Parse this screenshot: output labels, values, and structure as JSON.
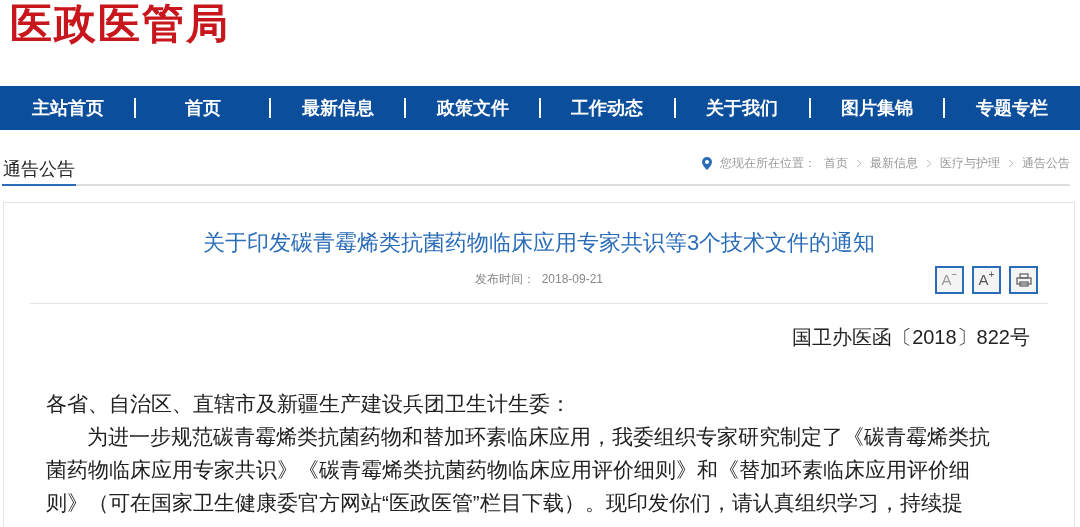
{
  "logo": "医政医管局",
  "nav": [
    "主站首页",
    "首页",
    "最新信息",
    "政策文件",
    "工作动态",
    "关于我们",
    "图片集锦",
    "专题专栏"
  ],
  "section_title": "通告公告",
  "breadcrumb": {
    "label": "您现在所在位置：",
    "items": [
      "首页",
      "最新信息",
      "医疗与护理",
      "通告公告"
    ]
  },
  "article": {
    "title": "关于印发碳青霉烯类抗菌药物临床应用专家共识等3个技术文件的通知",
    "date_label": "发布时间：",
    "date": "2018-09-21",
    "tools": [
      {
        "kind": "smaller",
        "label": "A",
        "mark": "−"
      },
      {
        "kind": "larger",
        "label": "A",
        "mark": "+"
      },
      {
        "kind": "print"
      }
    ],
    "doc_number": "国卫办医函〔2018〕822号",
    "greeting": "各省、自治区、直辖市及新疆生产建设兵团卫生计生委：",
    "paragraph": "为进一步规范碳青霉烯类抗菌药物和替加环素临床应用，我委组织专家研究制定了《碳青霉烯类抗菌药物临床应用专家共识》《碳青霉烯类抗菌药物临床应用评价细则》和《替加环素临床应用评价细则》（可在国家卫生健康委官方网站“医政医管”栏目下载）。现印发你们，请认真组织学习，持续提"
  }
}
